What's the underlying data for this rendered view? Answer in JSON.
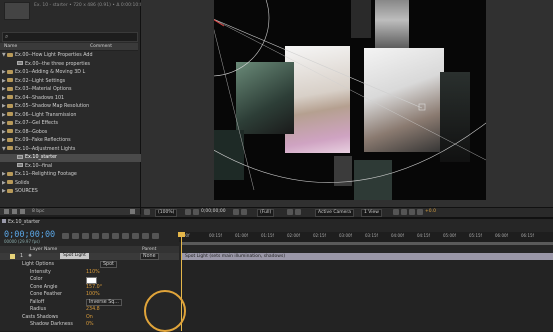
{
  "project": {
    "top_text": "Ex. 10 - starter • 720 x 486 (0.91) • Δ 0:00:10:00, 29.97 fps",
    "search_placeholder": "",
    "columns": {
      "name": "Name",
      "comment": "Comment"
    },
    "items": [
      {
        "label": "Ex.00--How Light Properties Add",
        "kind": "folder",
        "tri": "▼",
        "indent": 0
      },
      {
        "label": "Ex.00--the three properties",
        "kind": "comp",
        "tri": "",
        "indent": 1
      },
      {
        "label": "Ex.01--Adding & Moving 3D L",
        "kind": "folder",
        "tri": "▶",
        "indent": 0
      },
      {
        "label": "Ex.02--Light Settings",
        "kind": "folder",
        "tri": "▶",
        "indent": 0
      },
      {
        "label": "Ex.03--Material Options",
        "kind": "folder",
        "tri": "▶",
        "indent": 0
      },
      {
        "label": "Ex.04--Shadows 101",
        "kind": "folder",
        "tri": "▶",
        "indent": 0
      },
      {
        "label": "Ex.05--Shadow Map Resolution",
        "kind": "folder",
        "tri": "▶",
        "indent": 0
      },
      {
        "label": "Ex.06--Light Transmission",
        "kind": "folder",
        "tri": "▶",
        "indent": 0
      },
      {
        "label": "Ex.07--Gel Effects",
        "kind": "folder",
        "tri": "▶",
        "indent": 0
      },
      {
        "label": "Ex.08--Gobos",
        "kind": "folder",
        "tri": "▶",
        "indent": 0
      },
      {
        "label": "Ex.09--Fake Reflections",
        "kind": "folder",
        "tri": "▶",
        "indent": 0
      },
      {
        "label": "Ex.10--Adjustment Lights",
        "kind": "folder",
        "tri": "▼",
        "indent": 0
      },
      {
        "label": "Ex.10_starter",
        "kind": "comp",
        "tri": "",
        "indent": 1,
        "selected": true
      },
      {
        "label": "Ex.10--final",
        "kind": "comp",
        "tri": "",
        "indent": 1
      },
      {
        "label": "Ex.11--Relighting Footage",
        "kind": "folder",
        "tri": "▶",
        "indent": 0
      },
      {
        "label": "Solids",
        "kind": "folder",
        "tri": "▶",
        "indent": 0
      },
      {
        "label": "SOURCES",
        "kind": "folder",
        "tri": "▶",
        "indent": 0
      }
    ],
    "footer_bpc": "8 bpc"
  },
  "viewer_toolbar": {
    "zoom": "(100%)",
    "timecode": "0;00;00;00",
    "resolution": "(Full)",
    "camera": "Active Camera",
    "view": "1 View",
    "exposure": "+0.0"
  },
  "timeline": {
    "tab": "Ex.10_starter",
    "timecode": "0;00;00;00",
    "fps": "00000 (29.97 fps)",
    "ruler_ticks": [
      "00f",
      "00:15f",
      "01:00f",
      "01:15f",
      "02:00f",
      "02:15f",
      "03:00f",
      "03:15f",
      "04:00f",
      "04:15f",
      "05:00f",
      "05:15f",
      "06:00f",
      "06:15f"
    ],
    "header": {
      "layer_name": "Layer Name",
      "parent": "Parent"
    },
    "layer": {
      "number": "1",
      "name": "Spot Light",
      "parent": "None"
    },
    "track_text": "Spot Light (sets main illumination, shadows)",
    "properties": [
      {
        "name": "Light Options",
        "value": "",
        "select": "Spot"
      },
      {
        "name": "Intensity",
        "value": "110%",
        "select": ""
      },
      {
        "name": "Color",
        "value": "",
        "select": "",
        "swatch": true
      },
      {
        "name": "Cone Angle",
        "value": "157.0°",
        "select": ""
      },
      {
        "name": "Cone Feather",
        "value": "100%",
        "select": ""
      },
      {
        "name": "Falloff",
        "value": "",
        "select": "Inverse Sq..."
      },
      {
        "name": "Radius",
        "value": "234.8",
        "select": ""
      },
      {
        "name": "Casts Shadows",
        "value": "On",
        "select": ""
      },
      {
        "name": "Shadow Darkness",
        "value": "0%",
        "select": ""
      }
    ]
  }
}
